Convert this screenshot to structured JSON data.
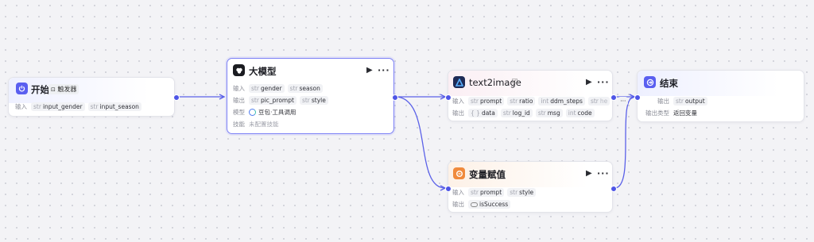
{
  "nodes": {
    "start": {
      "title": "开始",
      "badge": "触发器",
      "input_label": "输入",
      "params": [
        {
          "type": "str",
          "name": "input_gender"
        },
        {
          "type": "str",
          "name": "input_season"
        }
      ]
    },
    "llm": {
      "title": "大模型",
      "input_label": "输入",
      "output_label": "输出",
      "model_label": "模型",
      "skill_label": "技能",
      "inputs": [
        {
          "type": "str",
          "name": "gender"
        },
        {
          "type": "str",
          "name": "season"
        }
      ],
      "outputs": [
        {
          "type": "str",
          "name": "pic_prompt"
        },
        {
          "type": "str",
          "name": "style"
        }
      ],
      "model": "豆包·工具调用",
      "skill": "未配置技能"
    },
    "t2i": {
      "title": "text2image",
      "input_label": "输入",
      "output_label": "输出",
      "inputs": [
        {
          "type": "str",
          "name": "prompt"
        },
        {
          "type": "str",
          "name": "ratio"
        },
        {
          "type": "int",
          "name": "ddm_steps"
        },
        {
          "type": "str",
          "name": "he"
        }
      ],
      "overflow": "···",
      "outputs": [
        {
          "type": "{ }",
          "name": "data"
        },
        {
          "type": "str",
          "name": "log_id"
        },
        {
          "type": "str",
          "name": "msg"
        },
        {
          "type": "int",
          "name": "code"
        }
      ]
    },
    "assign": {
      "title": "变量赋值",
      "input_label": "输入",
      "output_label": "输出",
      "inputs": [
        {
          "type": "str",
          "name": "prompt"
        },
        {
          "type": "str",
          "name": "style"
        }
      ],
      "outputs": [
        {
          "type": "bool",
          "name": "isSuccess"
        }
      ]
    },
    "end": {
      "title": "结束",
      "output_label": "输出",
      "output_type_label": "输出类型",
      "outputs": [
        {
          "type": "str",
          "name": "output"
        }
      ],
      "output_type": "返回变量"
    }
  },
  "colors": {
    "accent": "#4e55e6",
    "edge": "#5b61e8",
    "start_icon": "#5a5ff0",
    "llm_icon": "#1b1c21",
    "t2i_icon": "#1f2a55",
    "assign_icon": "#f08a3c",
    "end_icon": "#5a5ff0"
  },
  "icons": {
    "start": "power-icon",
    "llm": "llm-icon",
    "t2i": "app-logo-icon",
    "assign": "variable-assign-icon",
    "end": "exit-icon",
    "run": "play-icon",
    "more": "more-icon",
    "model": "doubao-icon",
    "badge": "trigger-icon",
    "certified": "certified-icon"
  }
}
